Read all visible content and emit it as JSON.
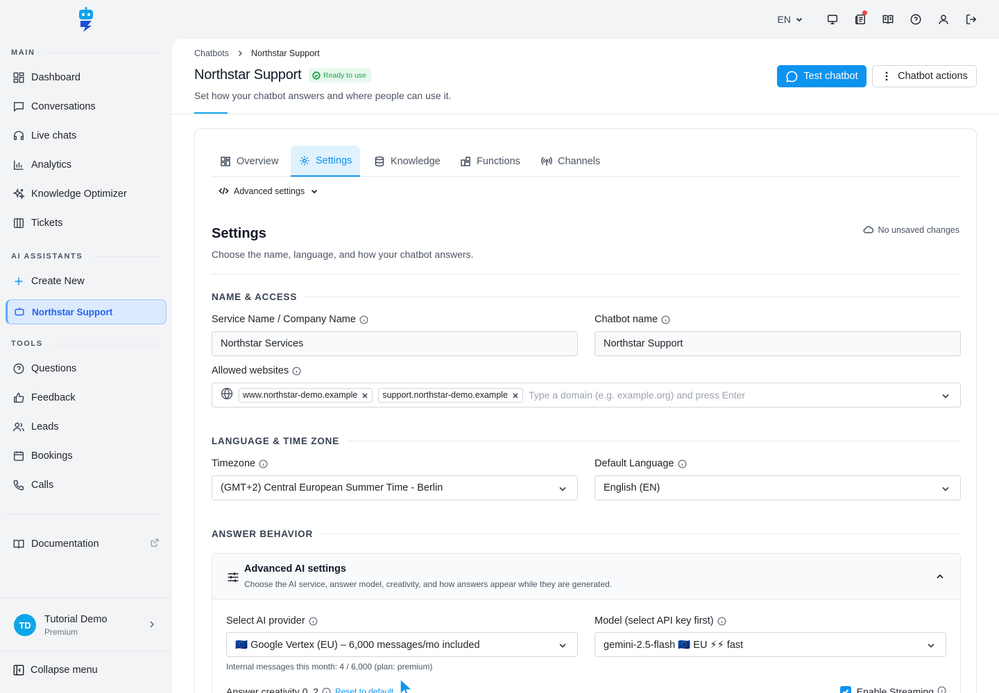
{
  "sidebar": {
    "main_title": "MAIN",
    "main_items": [
      {
        "label": "Dashboard",
        "icon": "dashboard-icon"
      },
      {
        "label": "Conversations",
        "icon": "message-square-icon"
      },
      {
        "label": "Live chats",
        "icon": "headset-icon"
      },
      {
        "label": "Analytics",
        "icon": "bar-chart-icon"
      },
      {
        "label": "Knowledge Optimizer",
        "icon": "sparkles-icon"
      },
      {
        "label": "Tickets",
        "icon": "columns-icon"
      }
    ],
    "assistants_title": "AI ASSISTANTS",
    "create_new": "Create New",
    "active_assistant": "Northstar Support",
    "tools_title": "TOOLS",
    "tools_items": [
      {
        "label": "Questions",
        "icon": "help-circle-icon"
      },
      {
        "label": "Feedback",
        "icon": "thumbs-up-icon"
      },
      {
        "label": "Leads",
        "icon": "users-icon"
      },
      {
        "label": "Bookings",
        "icon": "calendar-icon"
      },
      {
        "label": "Calls",
        "icon": "phone-icon"
      }
    ],
    "documentation": "Documentation",
    "user": {
      "initials": "TD",
      "name": "Tutorial Demo",
      "plan": "Premium"
    },
    "collapse": "Collapse menu"
  },
  "topbar": {
    "language": "EN",
    "icons": [
      "monitor-icon",
      "news-icon",
      "book-icon",
      "help-icon",
      "user-icon",
      "logout-icon"
    ]
  },
  "header": {
    "breadcrumbs": [
      "Chatbots",
      "Northstar Support"
    ],
    "title": "Northstar Support",
    "status_badge": "Ready to use",
    "subtitle": "Set how your chatbot answers and where people can use it.",
    "test_button": "Test chatbot",
    "actions_button": "Chatbot actions"
  },
  "tabs": [
    {
      "label": "Overview",
      "icon": "grid-icon"
    },
    {
      "label": "Settings",
      "icon": "gear-icon",
      "active": true
    },
    {
      "label": "Knowledge",
      "icon": "database-icon"
    },
    {
      "label": "Functions",
      "icon": "puzzle-icon"
    },
    {
      "label": "Channels",
      "icon": "broadcast-icon"
    }
  ],
  "advanced_toggle": "Advanced settings",
  "settings": {
    "title": "Settings",
    "subtitle": "Choose the name, language, and how your chatbot answers.",
    "save_state": "No unsaved changes",
    "name_access": {
      "heading": "NAME & ACCESS",
      "service_label": "Service Name / Company Name",
      "service_value": "Northstar Services",
      "chatbot_label": "Chatbot name",
      "chatbot_value": "Northstar Support",
      "websites_label": "Allowed websites",
      "websites": [
        "www.northstar-demo.example",
        "support.northstar-demo.example"
      ],
      "websites_placeholder": "Type a domain (e.g. example.org) and press Enter"
    },
    "language_tz": {
      "heading": "LANGUAGE & TIME ZONE",
      "timezone_label": "Timezone",
      "timezone_value": "(GMT+2) Central European Summer Time - Berlin",
      "language_label": "Default Language",
      "language_value": "English (EN)"
    },
    "answer_behavior": {
      "heading": "ANSWER BEHAVIOR",
      "ai_title": "Advanced AI settings",
      "ai_subtitle": "Choose the AI service, answer model, creativity, and how answers appear while they are generated.",
      "provider_label": "Select AI provider",
      "provider_value": "🇪🇺 Google Vertex (EU) – 6,000 messages/mo included",
      "model_label": "Model (select API key first)",
      "model_value": "gemini-2.5-flash 🇪🇺 EU ⚡⚡ fast",
      "messages_note": "Internal messages this month: 4 / 6,000 (plan: premium)",
      "creativity_label": "Answer creativity 0. 2",
      "reset_link": "Reset to default",
      "streaming_label": "Enable Streaming"
    }
  },
  "colors": {
    "accent": "#0d93f0",
    "success": "#16a34a",
    "active_bg": "#dbeafe"
  }
}
